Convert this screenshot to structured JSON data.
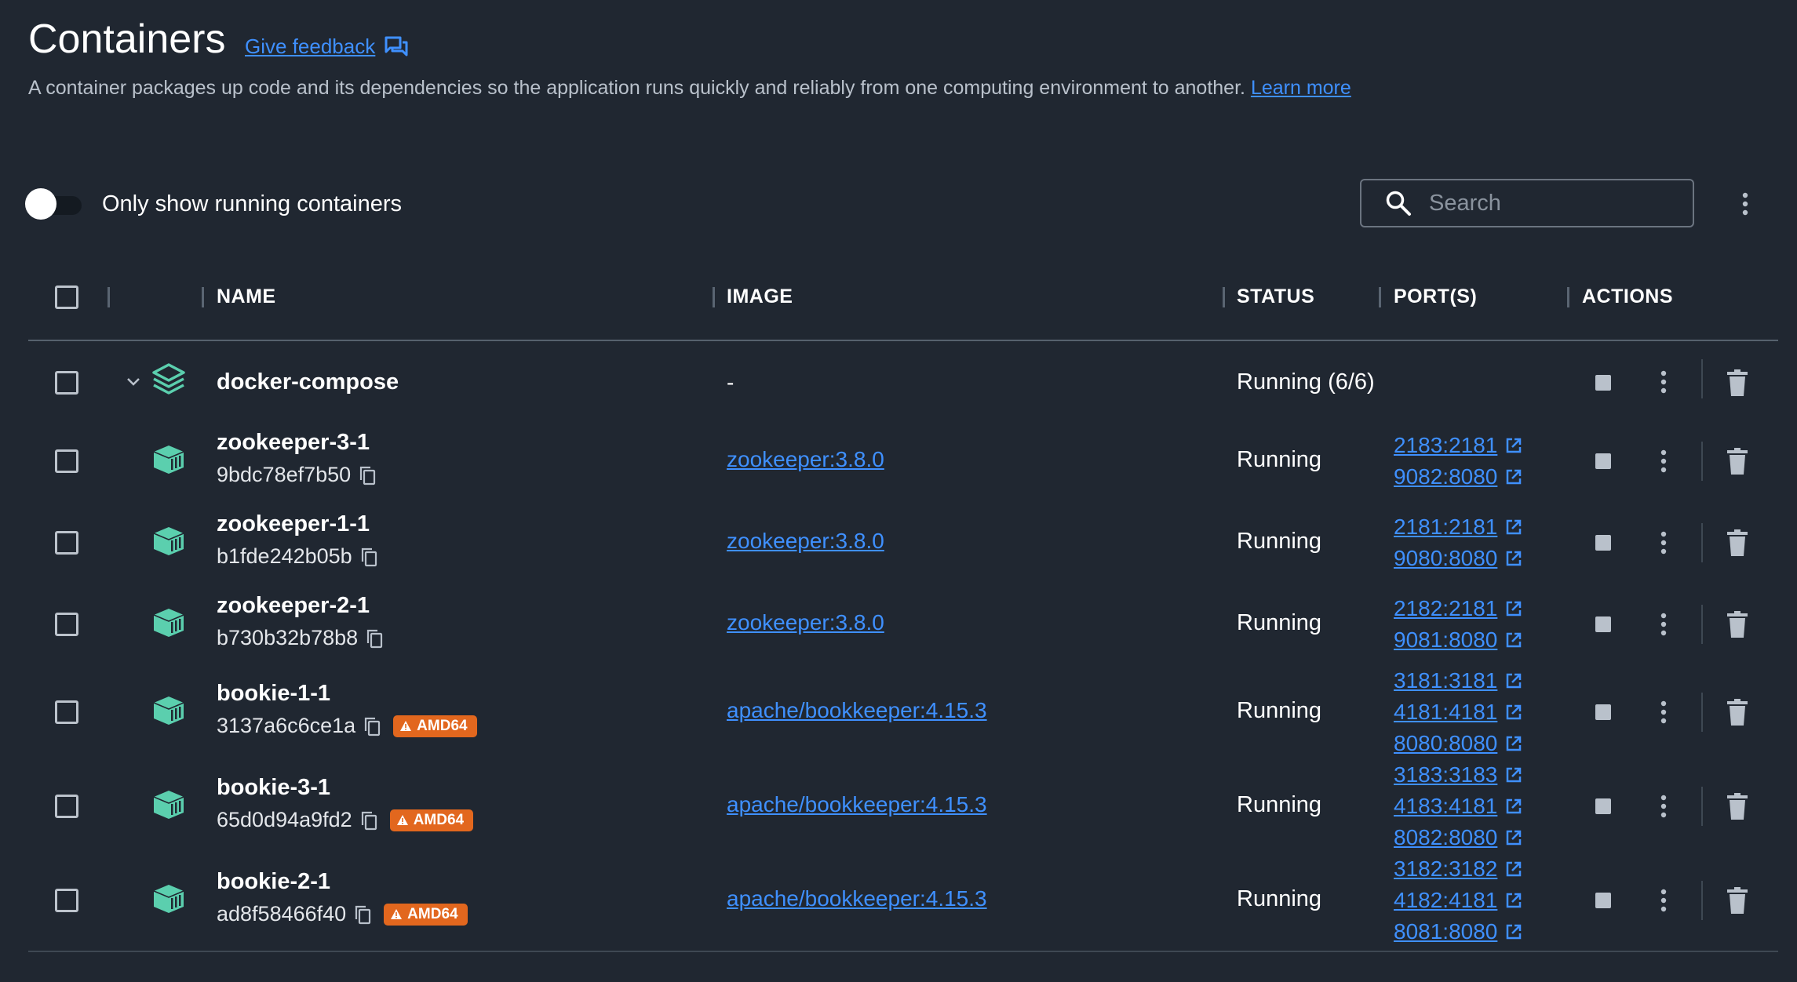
{
  "page": {
    "title": "Containers",
    "feedback_label": "Give feedback",
    "description": "A container packages up code and its dependencies so the application runs quickly and reliably from one computing environment to another.",
    "learn_more": "Learn more"
  },
  "toolbar": {
    "toggle_label": "Only show running containers",
    "toggle_on": false,
    "search_placeholder": "Search"
  },
  "table": {
    "columns": {
      "name": "NAME",
      "image": "IMAGE",
      "status": "STATUS",
      "ports": "PORT(S)",
      "actions": "ACTIONS"
    },
    "group": {
      "name": "docker-compose",
      "image": "-",
      "status": "Running (6/6)"
    },
    "rows": [
      {
        "name": "zookeeper-3-1",
        "id": "9bdc78ef7b50",
        "image": "zookeeper:3.8.0",
        "status": "Running",
        "arch": "",
        "ports": [
          "2183:2181",
          "9082:8080"
        ]
      },
      {
        "name": "zookeeper-1-1",
        "id": "b1fde242b05b",
        "image": "zookeeper:3.8.0",
        "status": "Running",
        "arch": "",
        "ports": [
          "2181:2181",
          "9080:8080"
        ]
      },
      {
        "name": "zookeeper-2-1",
        "id": "b730b32b78b8",
        "image": "zookeeper:3.8.0",
        "status": "Running",
        "arch": "",
        "ports": [
          "2182:2181",
          "9081:8080"
        ]
      },
      {
        "name": "bookie-1-1",
        "id": "3137a6c6ce1a",
        "image": "apache/bookkeeper:4.15.3",
        "status": "Running",
        "arch": "AMD64",
        "ports": [
          "3181:3181",
          "4181:4181",
          "8080:8080"
        ]
      },
      {
        "name": "bookie-3-1",
        "id": "65d0d94a9fd2",
        "image": "apache/bookkeeper:4.15.3",
        "status": "Running",
        "arch": "AMD64",
        "ports": [
          "3183:3183",
          "4183:4181",
          "8082:8080"
        ]
      },
      {
        "name": "bookie-2-1",
        "id": "ad8f58466f40",
        "image": "apache/bookkeeper:4.15.3",
        "status": "Running",
        "arch": "AMD64",
        "ports": [
          "3182:3182",
          "4182:4181",
          "8081:8080"
        ]
      }
    ]
  },
  "colors": {
    "background": "#202731",
    "link": "#3f90ff",
    "container_icon": "#5bcfae",
    "badge": "#e2671e"
  }
}
